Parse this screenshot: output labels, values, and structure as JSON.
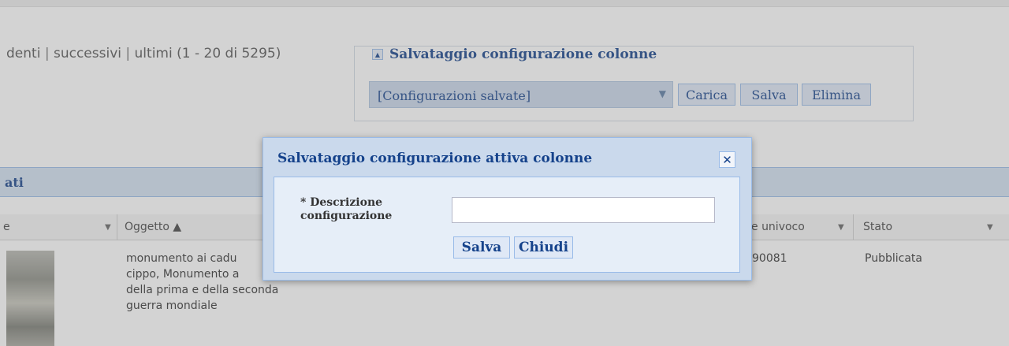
{
  "pager": {
    "prev": "denti",
    "sep1": " | ",
    "next": "successivi",
    "sep2": " | ",
    "last": "ultimi",
    "range": " (1 - 20 di 5295)"
  },
  "save_config": {
    "legend": "Salvataggio configurazione colonne",
    "select_value": "[Configurazioni salvate]",
    "load_label": "Carica",
    "save_label": "Salva",
    "delete_label": "Elimina"
  },
  "grid": {
    "title": "ati",
    "columns": [
      {
        "label": "e"
      },
      {
        "label": "Oggetto ▲"
      },
      {
        "label": "e univoco"
      },
      {
        "label": "Stato"
      }
    ],
    "row": {
      "object_lines": [
        "monumento ai cadu",
        "cippo, Monumento a",
        "della prima e della seconda",
        "guerra mondiale"
      ],
      "code": "90081",
      "status": "Pubblicata"
    }
  },
  "dialog": {
    "title": "Salvataggio configurazione attiva colonne",
    "close_glyph": "✕",
    "field_label_line1": "* Descrizione",
    "field_label_line2": "configurazione",
    "field_value": "",
    "save_label": "Salva",
    "close_label": "Chiudi"
  },
  "icons": {
    "legend_toggle": "collapse-arrow-icon",
    "select_arrow": "chevron-down-icon",
    "dialog_close": "close-icon"
  }
}
